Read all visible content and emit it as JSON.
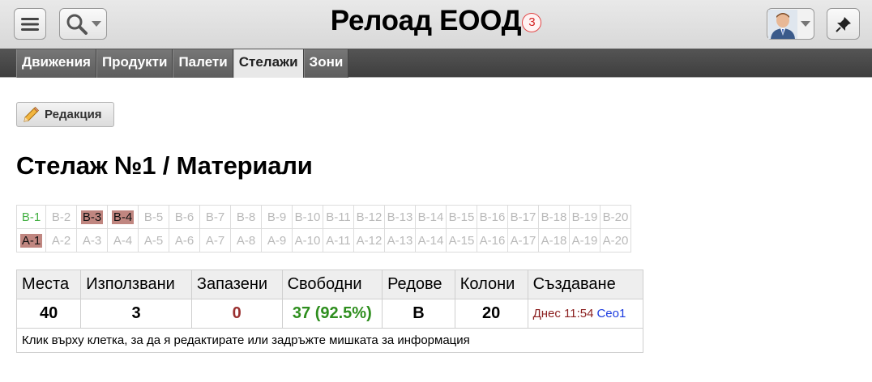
{
  "header": {
    "title": "Релоад ЕООД",
    "notification_count": "3",
    "icons": {
      "menu": "hamburger-menu-icon",
      "search": "magnifier-icon",
      "avatar": "user-avatar",
      "pin": "pushpin-icon"
    }
  },
  "tabs": [
    {
      "label": "Движения",
      "active": false
    },
    {
      "label": "Продукти",
      "active": false
    },
    {
      "label": "Палети",
      "active": false
    },
    {
      "label": "Стелажи",
      "active": true
    },
    {
      "label": "Зони",
      "active": false
    }
  ],
  "toolbar": {
    "edit_label": "Редакция"
  },
  "page": {
    "title": "Стелаж №1 / Материали"
  },
  "rack": {
    "rows": [
      [
        "В-1",
        "В-2",
        "В-3",
        "В-4",
        "В-5",
        "В-6",
        "В-7",
        "В-8",
        "В-9",
        "В-10",
        "В-11",
        "В-12",
        "В-13",
        "В-14",
        "В-15",
        "В-16",
        "В-17",
        "В-18",
        "В-19",
        "В-20"
      ],
      [
        "А-1",
        "А-2",
        "А-3",
        "А-4",
        "А-5",
        "А-6",
        "А-7",
        "А-8",
        "А-9",
        "А-10",
        "А-11",
        "А-12",
        "А-13",
        "А-14",
        "А-15",
        "А-16",
        "А-17",
        "А-18",
        "А-19",
        "А-20"
      ]
    ],
    "used_cells": [
      "В-3",
      "В-4",
      "А-1"
    ],
    "green_cells": [
      "В-1"
    ],
    "colors": {
      "used": "#c08680",
      "green": "#43b043",
      "empty": "#b9b9b9"
    }
  },
  "stats": {
    "headers": {
      "places": "Места",
      "used": "Използвани",
      "reserved": "Запазени",
      "free": "Свободни",
      "rows": "Редове",
      "columns": "Колони",
      "created": "Създаване"
    },
    "values": {
      "places": "40",
      "used": "3",
      "reserved": "0",
      "free": "37 (92.5%)",
      "rows": "B",
      "columns": "20",
      "created_date": "Днес 11:54",
      "created_user": "Ceo1"
    },
    "hint": "Клик върху клетка, за да я редактирате или задръжте мишката за информация"
  }
}
